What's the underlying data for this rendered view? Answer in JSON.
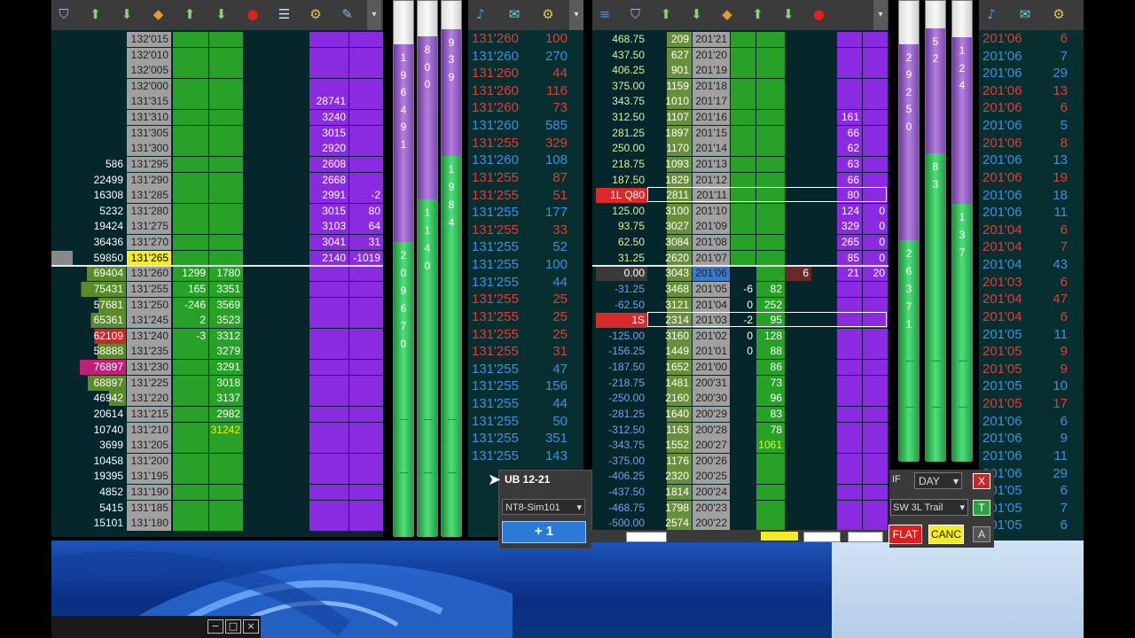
{
  "colors": {
    "bg": "#05262a",
    "bid_green": "#28a128",
    "ask_purple": "#8a2be2",
    "price_gray": "#a0a0a0",
    "red": "#e23b3b",
    "blue": "#3f8fe0",
    "highlight_yellow": "#f2ef1a"
  },
  "toolbar_left": {
    "icons": [
      "save-icon",
      "export-icon",
      "import-icon",
      "clear-icon",
      "export-icon",
      "import-icon",
      "alert-icon",
      "properties-icon",
      "instrument-icon",
      "tools-icon"
    ]
  },
  "toolbar_mid": {
    "icons": [
      "market-analyzer-icon",
      "chat-icon",
      "instrument-icon"
    ]
  },
  "toolbar_right": {
    "icons": [
      "menu-icon",
      "save-icon",
      "export-icon",
      "import-icon",
      "clear-icon",
      "export-icon",
      "import-icon",
      "alert-icon"
    ]
  },
  "ladder_left": {
    "rows": [
      {
        "vol": "",
        "price": "132'015",
        "bid": "",
        "bidv": "",
        "askv": "",
        "ask": ""
      },
      {
        "vol": "",
        "price": "132'010",
        "bid": "",
        "bidv": "",
        "askv": "",
        "ask": ""
      },
      {
        "vol": "",
        "price": "132'005",
        "bid": "",
        "bidv": "",
        "askv": "",
        "ask": ""
      },
      {
        "vol": "",
        "price": "132'000",
        "bid": "",
        "bidv": "",
        "askv": "",
        "ask": ""
      },
      {
        "vol": "",
        "price": "131'315",
        "bid": "",
        "bidv": "",
        "askv": "28741",
        "ask": ""
      },
      {
        "vol": "",
        "price": "131'310",
        "bid": "",
        "bidv": "",
        "askv": "3240",
        "ask": ""
      },
      {
        "vol": "",
        "price": "131'305",
        "bid": "",
        "bidv": "",
        "askv": "3015",
        "ask": ""
      },
      {
        "vol": "",
        "price": "131'300",
        "bid": "",
        "bidv": "",
        "askv": "2920",
        "ask": ""
      },
      {
        "vol": "586",
        "price": "131'295",
        "bid": "",
        "bidv": "",
        "askv": "2608",
        "ask": ""
      },
      {
        "vol": "22499",
        "price": "131'290",
        "bid": "",
        "bidv": "",
        "askv": "2668",
        "ask": ""
      },
      {
        "vol": "16308",
        "price": "131'285",
        "bid": "",
        "bidv": "",
        "askv": "2991",
        "ask": "-2"
      },
      {
        "vol": "5232",
        "price": "131'280",
        "bid": "",
        "bidv": "",
        "askv": "3015",
        "ask": "80"
      },
      {
        "vol": "19424",
        "price": "131'275",
        "bid": "",
        "bidv": "",
        "askv": "3103",
        "ask": "64"
      },
      {
        "vol": "36436",
        "price": "131'270",
        "bid": "",
        "bidv": "",
        "askv": "3041",
        "ask": "31"
      },
      {
        "vol": "59850",
        "price": "131'265",
        "bid": "",
        "bidv": "",
        "askv": "2140",
        "ask": "-1019"
      },
      {
        "vol": "69404",
        "price": "131'260",
        "bid": "1299",
        "bidv": "1780",
        "askv": "",
        "ask": ""
      },
      {
        "vol": "75431",
        "price": "131'255",
        "bid": "165",
        "bidv": "3351",
        "askv": "",
        "ask": ""
      },
      {
        "vol": "57681",
        "price": "131'250",
        "bid": "-246",
        "bidv": "3569",
        "askv": "",
        "ask": ""
      },
      {
        "vol": "65361",
        "price": "131'245",
        "bid": "2",
        "bidv": "3523",
        "askv": "",
        "ask": ""
      },
      {
        "vol": "62109",
        "price": "131'240",
        "bid": "-3",
        "bidv": "3312",
        "askv": "",
        "ask": ""
      },
      {
        "vol": "58888",
        "price": "131'235",
        "bid": "",
        "bidv": "3279",
        "askv": "",
        "ask": ""
      },
      {
        "vol": "76897",
        "price": "131'230",
        "bid": "",
        "bidv": "3291",
        "askv": "",
        "ask": ""
      },
      {
        "vol": "68897",
        "price": "131'225",
        "bid": "",
        "bidv": "3018",
        "askv": "",
        "ask": ""
      },
      {
        "vol": "46942",
        "price": "131'220",
        "bid": "",
        "bidv": "3137",
        "askv": "",
        "ask": ""
      },
      {
        "vol": "20614",
        "price": "131'215",
        "bid": "",
        "bidv": "2982",
        "askv": "",
        "ask": ""
      },
      {
        "vol": "10740",
        "price": "131'210",
        "bid": "",
        "bidv": "31242",
        "askv": "",
        "ask": ""
      },
      {
        "vol": "3699",
        "price": "131'205",
        "bid": "",
        "bidv": "",
        "askv": "",
        "ask": ""
      },
      {
        "vol": "10458",
        "price": "131'200",
        "bid": "",
        "bidv": "",
        "askv": "",
        "ask": ""
      },
      {
        "vol": "19395",
        "price": "131'195",
        "bid": "",
        "bidv": "",
        "askv": "",
        "ask": ""
      },
      {
        "vol": "4852",
        "price": "131'190",
        "bid": "",
        "bidv": "",
        "askv": "",
        "ask": ""
      },
      {
        "vol": "5415",
        "price": "131'185",
        "bid": "",
        "bidv": "",
        "askv": "",
        "ask": ""
      },
      {
        "vol": "15101",
        "price": "131'180",
        "bid": "",
        "bidv": "",
        "askv": "",
        "ask": ""
      }
    ]
  },
  "meters_left": [
    {
      "top": [
        "1",
        "9",
        "6",
        "4",
        "9",
        "1"
      ],
      "bottom": [
        "2",
        "0",
        "9",
        "6",
        "7",
        "0"
      ],
      "split": 0.45
    },
    {
      "top": [
        "8",
        "0",
        "0"
      ],
      "bottom": [
        "1",
        "1",
        "4",
        "0"
      ],
      "split": 0.37
    },
    {
      "top": [
        "9",
        "3",
        "9"
      ],
      "bottom": [
        "1",
        "9",
        "8",
        "4"
      ],
      "split": 0.29
    }
  ],
  "tape_left": [
    {
      "p": "131'260",
      "q": "100",
      "c": "red"
    },
    {
      "p": "131'260",
      "q": "270",
      "c": "blue"
    },
    {
      "p": "131'260",
      "q": "44",
      "c": "red"
    },
    {
      "p": "131'260",
      "q": "116",
      "c": "red"
    },
    {
      "p": "131'260",
      "q": "73",
      "c": "red"
    },
    {
      "p": "131'260",
      "q": "585",
      "c": "blue"
    },
    {
      "p": "131'255",
      "q": "329",
      "c": "red"
    },
    {
      "p": "131'260",
      "q": "108",
      "c": "blue"
    },
    {
      "p": "131'255",
      "q": "87",
      "c": "red"
    },
    {
      "p": "131'255",
      "q": "51",
      "c": "red"
    },
    {
      "p": "131'255",
      "q": "177",
      "c": "blue"
    },
    {
      "p": "131'255",
      "q": "33",
      "c": "red"
    },
    {
      "p": "131'255",
      "q": "52",
      "c": "blue"
    },
    {
      "p": "131'255",
      "q": "100",
      "c": "blue"
    },
    {
      "p": "131'255",
      "q": "44",
      "c": "blue"
    },
    {
      "p": "131'255",
      "q": "25",
      "c": "red"
    },
    {
      "p": "131'255",
      "q": "25",
      "c": "red"
    },
    {
      "p": "131'255",
      "q": "25",
      "c": "red"
    },
    {
      "p": "131'255",
      "q": "31",
      "c": "red"
    },
    {
      "p": "131'255",
      "q": "47",
      "c": "blue"
    },
    {
      "p": "131'255",
      "q": "156",
      "c": "blue"
    },
    {
      "p": "131'255",
      "q": "44",
      "c": "blue"
    },
    {
      "p": "131'255",
      "q": "50",
      "c": "blue"
    },
    {
      "p": "131'255",
      "q": "351",
      "c": "blue"
    },
    {
      "p": "131'255",
      "q": "143",
      "c": "blue"
    }
  ],
  "ladder_right": {
    "rows": [
      {
        "pnl": "468.75",
        "vol": "209",
        "price": "201'21",
        "bid": "",
        "bidv": "",
        "ask": "",
        "askv": "",
        "tag": ""
      },
      {
        "pnl": "437.50",
        "vol": "627",
        "price": "201'20",
        "bid": "",
        "bidv": "",
        "ask": "",
        "askv": "",
        "tag": ""
      },
      {
        "pnl": "406.25",
        "vol": "901",
        "price": "201'19",
        "bid": "",
        "bidv": "",
        "ask": "",
        "askv": "",
        "tag": ""
      },
      {
        "pnl": "375.00",
        "vol": "1159",
        "price": "201'18",
        "bid": "",
        "bidv": "",
        "ask": "",
        "askv": "",
        "tag": ""
      },
      {
        "pnl": "343.75",
        "vol": "1010",
        "price": "201'17",
        "bid": "",
        "bidv": "",
        "ask": "",
        "askv": "",
        "tag": ""
      },
      {
        "pnl": "312.50",
        "vol": "1107",
        "price": "201'16",
        "bid": "",
        "bidv": "",
        "ask": "161",
        "askv": "",
        "tag": ""
      },
      {
        "pnl": "281.25",
        "vol": "1897",
        "price": "201'15",
        "bid": "",
        "bidv": "",
        "ask": "66",
        "askv": "",
        "tag": ""
      },
      {
        "pnl": "250.00",
        "vol": "1170",
        "price": "201'14",
        "bid": "",
        "bidv": "",
        "ask": "62",
        "askv": "",
        "tag": ""
      },
      {
        "pnl": "218.75",
        "vol": "1093",
        "price": "201'13",
        "bid": "",
        "bidv": "",
        "ask": "63",
        "askv": "",
        "tag": ""
      },
      {
        "pnl": "187.50",
        "vol": "1829",
        "price": "201'12",
        "bid": "",
        "bidv": "",
        "ask": "66",
        "askv": "",
        "tag": ""
      },
      {
        "pnl": "1L Q80",
        "vol": "2811",
        "price": "201'11",
        "bid": "",
        "bidv": "",
        "ask": "80",
        "askv": "",
        "tag": "long"
      },
      {
        "pnl": "125.00",
        "vol": "3100",
        "price": "201'10",
        "bid": "",
        "bidv": "",
        "ask": "124",
        "askv": "0",
        "tag": ""
      },
      {
        "pnl": "93.75",
        "vol": "3027",
        "price": "201'09",
        "bid": "",
        "bidv": "",
        "ask": "329",
        "askv": "0",
        "tag": ""
      },
      {
        "pnl": "62.50",
        "vol": "3084",
        "price": "201'08",
        "bid": "",
        "bidv": "",
        "ask": "265",
        "askv": "0",
        "tag": ""
      },
      {
        "pnl": "31.25",
        "vol": "2620",
        "price": "201'07",
        "bid": "",
        "bidv": "",
        "ask": "85",
        "askv": "0",
        "tag": ""
      },
      {
        "pnl": "0.00",
        "vol": "3043",
        "price": "201'06",
        "bid": "",
        "bidv": "6",
        "ask": "21",
        "askv": "20",
        "tag": "last"
      },
      {
        "pnl": "-31.25",
        "vol": "3468",
        "price": "201'05",
        "bid": "-6",
        "bidv": "82",
        "ask": "",
        "askv": "",
        "tag": ""
      },
      {
        "pnl": "-62.50",
        "vol": "3121",
        "price": "201'04",
        "bid": "0",
        "bidv": "252",
        "ask": "",
        "askv": "",
        "tag": ""
      },
      {
        "pnl": "1S",
        "vol": "2314",
        "price": "201'03",
        "bid": "-2",
        "bidv": "95",
        "ask": "",
        "askv": "",
        "tag": "short"
      },
      {
        "pnl": "-125.00",
        "vol": "3160",
        "price": "201'02",
        "bid": "0",
        "bidv": "128",
        "ask": "",
        "askv": "",
        "tag": ""
      },
      {
        "pnl": "-156.25",
        "vol": "1449",
        "price": "201'01",
        "bid": "0",
        "bidv": "88",
        "ask": "",
        "askv": "",
        "tag": ""
      },
      {
        "pnl": "-187.50",
        "vol": "1652",
        "price": "201'00",
        "bid": "",
        "bidv": "86",
        "ask": "",
        "askv": "",
        "tag": ""
      },
      {
        "pnl": "-218.75",
        "vol": "1481",
        "price": "200'31",
        "bid": "",
        "bidv": "73",
        "ask": "",
        "askv": "",
        "tag": ""
      },
      {
        "pnl": "-250.00",
        "vol": "2160",
        "price": "200'30",
        "bid": "",
        "bidv": "96",
        "ask": "",
        "askv": "",
        "tag": ""
      },
      {
        "pnl": "-281.25",
        "vol": "1640",
        "price": "200'29",
        "bid": "",
        "bidv": "83",
        "ask": "",
        "askv": "",
        "tag": ""
      },
      {
        "pnl": "-312.50",
        "vol": "1163",
        "price": "200'28",
        "bid": "",
        "bidv": "78",
        "ask": "",
        "askv": "",
        "tag": ""
      },
      {
        "pnl": "-343.75",
        "vol": "1552",
        "price": "200'27",
        "bid": "",
        "bidv": "1061",
        "ask": "",
        "askv": "",
        "tag": ""
      },
      {
        "pnl": "-375.00",
        "vol": "1176",
        "price": "200'26",
        "bid": "",
        "bidv": "",
        "ask": "",
        "askv": "",
        "tag": ""
      },
      {
        "pnl": "-406.25",
        "vol": "2320",
        "price": "200'25",
        "bid": "",
        "bidv": "",
        "ask": "",
        "askv": "",
        "tag": ""
      },
      {
        "pnl": "-437.50",
        "vol": "1814",
        "price": "200'24",
        "bid": "",
        "bidv": "",
        "ask": "",
        "askv": "",
        "tag": ""
      },
      {
        "pnl": "-468.75",
        "vol": "1798",
        "price": "200'23",
        "bid": "",
        "bidv": "",
        "ask": "",
        "askv": "",
        "tag": ""
      },
      {
        "pnl": "-500.00",
        "vol": "2574",
        "price": "200'22",
        "bid": "",
        "bidv": "",
        "ask": "",
        "askv": "",
        "tag": ""
      }
    ]
  },
  "meters_right": [
    {
      "top": [
        "2",
        "9",
        "2",
        "5",
        "0"
      ],
      "bottom": [
        "2",
        "6",
        "3",
        "7",
        "1"
      ],
      "split": 0.52
    },
    {
      "top": [
        "5",
        "2"
      ],
      "bottom": [
        "8",
        "3"
      ],
      "split": 0.33
    },
    {
      "top": [
        "1",
        "2",
        "4"
      ],
      "bottom": [
        "1",
        "3",
        "7"
      ],
      "split": 0.44
    }
  ],
  "tape_right": [
    {
      "p": "201'06",
      "q": "6",
      "c": "red"
    },
    {
      "p": "201'06",
      "q": "7",
      "c": "blue"
    },
    {
      "p": "201'06",
      "q": "29",
      "c": "blue"
    },
    {
      "p": "201'06",
      "q": "13",
      "c": "red"
    },
    {
      "p": "201'06",
      "q": "6",
      "c": "red"
    },
    {
      "p": "201'06",
      "q": "5",
      "c": "blue"
    },
    {
      "p": "201'06",
      "q": "8",
      "c": "red"
    },
    {
      "p": "201'06",
      "q": "13",
      "c": "blue"
    },
    {
      "p": "201'06",
      "q": "19",
      "c": "red"
    },
    {
      "p": "201'06",
      "q": "18",
      "c": "blue"
    },
    {
      "p": "201'06",
      "q": "11",
      "c": "blue"
    },
    {
      "p": "201'04",
      "q": "6",
      "c": "red"
    },
    {
      "p": "201'04",
      "q": "7",
      "c": "red"
    },
    {
      "p": "201'04",
      "q": "43",
      "c": "blue"
    },
    {
      "p": "201'03",
      "q": "6",
      "c": "red"
    },
    {
      "p": "201'04",
      "q": "47",
      "c": "red"
    },
    {
      "p": "201'04",
      "q": "6",
      "c": "red"
    },
    {
      "p": "201'05",
      "q": "11",
      "c": "blue"
    },
    {
      "p": "201'05",
      "q": "9",
      "c": "red"
    },
    {
      "p": "201'05",
      "q": "9",
      "c": "red"
    },
    {
      "p": "201'05",
      "q": "10",
      "c": "blue"
    },
    {
      "p": "201'05",
      "q": "17",
      "c": "red"
    },
    {
      "p": "201'06",
      "q": "6",
      "c": "blue"
    },
    {
      "p": "201'06",
      "q": "9",
      "c": "blue"
    },
    {
      "p": "201'06",
      "q": "11",
      "c": "blue"
    },
    {
      "p": "201'06",
      "q": "29",
      "c": "blue"
    },
    {
      "p": "201'05",
      "q": "6",
      "c": "blue"
    },
    {
      "p": "201'05",
      "q": "7",
      "c": "blue"
    },
    {
      "p": "201'05",
      "q": "6",
      "c": "blue"
    }
  ],
  "order_popup": {
    "instrument": "UB 12-21",
    "account": "NT8-Sim101",
    "qty_button": "+ 1"
  },
  "order_panel_right": {
    "tif": "DAY",
    "tif_label": "IF",
    "atm": "SW 3L Trail",
    "close_x": "X",
    "t_btn": "T",
    "flat": "FLAT",
    "canc": "CANC",
    "a_btn": "A"
  },
  "taskbar": {
    "minimize": "−",
    "maximize": "□",
    "close": "×"
  }
}
